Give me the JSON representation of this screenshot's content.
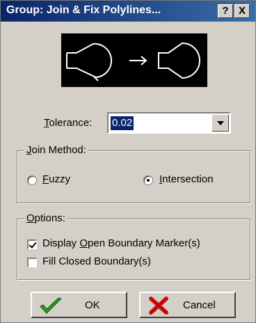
{
  "window": {
    "title": "Group: Join & Fix Polylines...",
    "help_button": "?",
    "close_button": "X"
  },
  "tolerance": {
    "label_u": "T",
    "label_rest": "olerance:",
    "value": "0.02"
  },
  "join_method": {
    "legend_u": "J",
    "legend_rest": "oin Method:",
    "options": [
      {
        "u": "F",
        "rest": "uzzy",
        "selected": false
      },
      {
        "u": "I",
        "rest": "ntersection",
        "selected": true
      }
    ]
  },
  "options_group": {
    "legend_u": "O",
    "legend_rest": "ptions:",
    "display_open": {
      "pre": "Display ",
      "u": "O",
      "rest": "pen Boundary Marker(s)",
      "checked": true
    },
    "fill_closed": {
      "label": "Fill Closed Boundary(s)",
      "checked": false
    }
  },
  "buttons": {
    "ok": "OK",
    "cancel": "Cancel"
  },
  "colors": {
    "ok_icon": "#22a022",
    "cancel_icon": "#d81010"
  }
}
